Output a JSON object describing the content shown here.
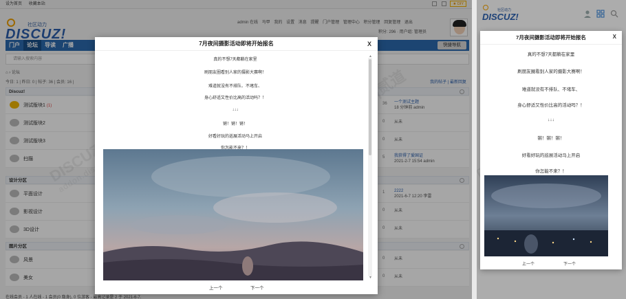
{
  "topbar": {
    "links": [
      "设为首页",
      "收藏本站"
    ],
    "diy": "★ DIY"
  },
  "header": {
    "logo_sub": "社区动力",
    "logo_main": "DISCUZ!",
    "user_menu": [
      "admin 在线",
      "马甲",
      "我的",
      "设置",
      "消息",
      "提醒",
      "门户管理",
      "管理中心",
      "积分管理",
      "回复管理",
      "退出"
    ],
    "user_menu2": "积分: 296 · 用户组: 管理员"
  },
  "nav": {
    "items": [
      "门户",
      "论坛",
      "导读",
      "广播"
    ],
    "quick": "快捷导航"
  },
  "search": {
    "placeholder": "请输入搜索内容"
  },
  "crumb": "论坛",
  "stats": {
    "left": "今日: 1 | 昨日: 0 | 帖子: 36 | 会员: 16 |",
    "right": "我的帖子 | 最新回复"
  },
  "categories": [
    {
      "name": "Discuz!"
    },
    {
      "name": "设计分区"
    },
    {
      "name": "图片分区"
    }
  ],
  "forums": [
    {
      "name": "测试版块1",
      "badge": "(1)",
      "num": "36",
      "last_link": "一个测试主题",
      "last_meta": "18 分钟前 admin"
    },
    {
      "name": "测试版块2",
      "badge": "",
      "num": "0",
      "last_link": "",
      "last_meta": "从未"
    },
    {
      "name": "测试版块3",
      "badge": "",
      "num": "0",
      "last_link": "",
      "last_meta": "从未"
    },
    {
      "name": "扫描",
      "badge": "",
      "num": "5",
      "last_link": "我获得了爱国证",
      "last_meta": "2021-2-7 15:54 admin"
    },
    {
      "name": "平面设计",
      "badge": "",
      "num": "1",
      "last_link": "2222",
      "last_meta": "2021-6-7 12:20 李雷"
    },
    {
      "name": "影视设计",
      "badge": "",
      "num": "0",
      "last_link": "",
      "last_meta": "从未"
    },
    {
      "name": "3D设计",
      "badge": "",
      "num": "0",
      "last_link": "",
      "last_meta": "从未"
    },
    {
      "name": "风景",
      "badge": "",
      "num": "0",
      "last_link": "",
      "last_meta": "从未"
    },
    {
      "name": "美女",
      "badge": "",
      "num": "0",
      "last_link": "",
      "last_meta": "从未"
    }
  ],
  "footer_line": "在线会员 - 1 人在线 - 1 会员(0 隐身), 0 位游客 - 最高记录是 2 于 2021-6-7.",
  "watermark": {
    "main": "DISCUZ!应用中心|贰道",
    "sub": "addon.dismall.com"
  },
  "modal": {
    "title": "7月夜间摄影活动即将开始报名",
    "close": "X",
    "lines": [
      "真的不想7天都躺在家里",
      "刷朋友圈看别人家的摄影大赛啊！",
      "难道就没有不排队、不堵车、",
      "身心舒适又性价比高的活动吗？！",
      "↓↓↓",
      "锵！锵！锵！",
      "好看好玩的巡展活动马上开启",
      "你怎能不来？！"
    ],
    "prev": "上一个",
    "next": "下一个"
  },
  "mobile": {
    "logo_sub": "社区动力",
    "logo_main": "DISCUZ!"
  },
  "colors": {
    "brand_blue": "#2b6ab0",
    "logo_blue": "#2b5fad",
    "accent_orange": "#f0a000",
    "hot_forum": "#f2b705"
  }
}
